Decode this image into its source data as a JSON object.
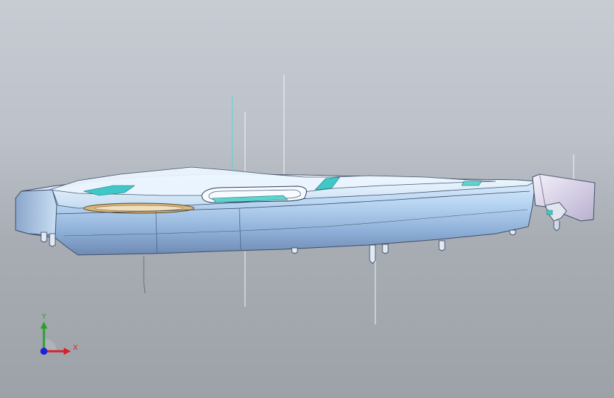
{
  "viewport": {
    "background_top": "#c7ccd3",
    "background_bottom": "#9da2a9"
  },
  "model": {
    "shell_color": "#b8d2f0",
    "shell_dark": "#6b87ad",
    "accent_cyan": "#3ec8c8",
    "accent_tan": "#d9b57a"
  },
  "triad": {
    "x_label": "X",
    "y_label": "Y",
    "x_color": "#d8202a",
    "y_color": "#2aa02a",
    "z_color": "#2020d8"
  }
}
